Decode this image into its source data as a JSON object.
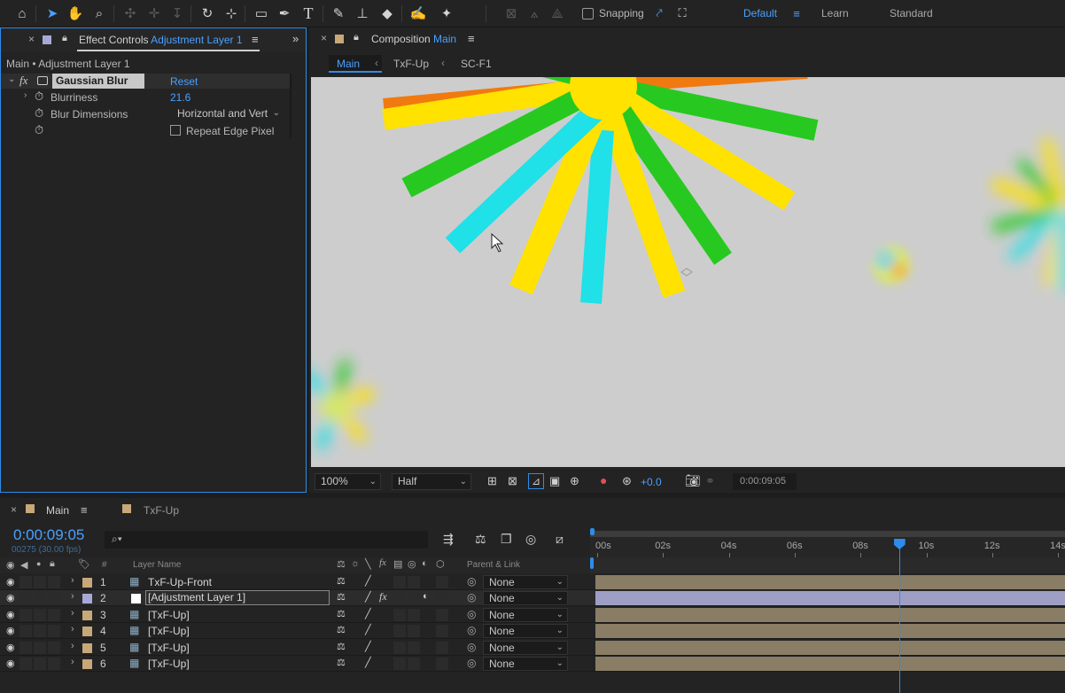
{
  "toolbar": {
    "snapping_label": "Snapping",
    "workspaces": [
      "Default",
      "Learn",
      "Standard"
    ],
    "active_workspace": "Default"
  },
  "effect_controls": {
    "tab_prefix": "Effect Controls",
    "tab_layer": "Adjustment Layer 1",
    "breadcrumb": "Main • Adjustment Layer 1",
    "effect_name": "Gaussian Blur",
    "reset_label": "Reset",
    "blurriness_label": "Blurriness",
    "blurriness_value": "21.6",
    "blur_dimensions_label": "Blur Dimensions",
    "blur_dimensions_value": "Horizontal and Vert",
    "repeat_edge_label": "Repeat Edge Pixel"
  },
  "composition": {
    "tab_prefix": "Composition",
    "tab_name": "Main",
    "breadcrumbs": [
      "Main",
      "TxF-Up",
      "SC-F1"
    ],
    "zoom": "100%",
    "resolution": "Half",
    "exposure": "+0.0",
    "timecode": "0:00:09:05"
  },
  "timeline": {
    "tabs": [
      "Main",
      "TxF-Up"
    ],
    "timecode": "0:00:09:05",
    "frame_info": "00275 (30.00 fps)",
    "col_number": "#",
    "col_layer_name": "Layer Name",
    "col_parent": "Parent & Link",
    "ruler": [
      "00s",
      "02s",
      "04s",
      "06s",
      "08s",
      "10s",
      "12s",
      "14s"
    ],
    "playhead_seconds": 9.17,
    "layers": [
      {
        "num": "1",
        "name": "TxF-Up-Front",
        "parent": "None",
        "label_color": "#c8a878"
      },
      {
        "num": "2",
        "name": "[Adjustment Layer 1]",
        "parent": "None",
        "label_color": "#a8a8d8"
      },
      {
        "num": "3",
        "name": "[TxF-Up]",
        "parent": "None",
        "label_color": "#c8a878"
      },
      {
        "num": "4",
        "name": "[TxF-Up]",
        "parent": "None",
        "label_color": "#c8a878"
      },
      {
        "num": "5",
        "name": "[TxF-Up]",
        "parent": "None",
        "label_color": "#c8a878"
      },
      {
        "num": "6",
        "name": "[TxF-Up]",
        "parent": "None",
        "label_color": "#c8a878"
      }
    ]
  },
  "colors": {
    "accent": "#2d8ceb",
    "bar_footage": "#8a7d65",
    "bar_adjustment": "#9e9ec4",
    "viewer_bg": "#cdcdcd"
  }
}
